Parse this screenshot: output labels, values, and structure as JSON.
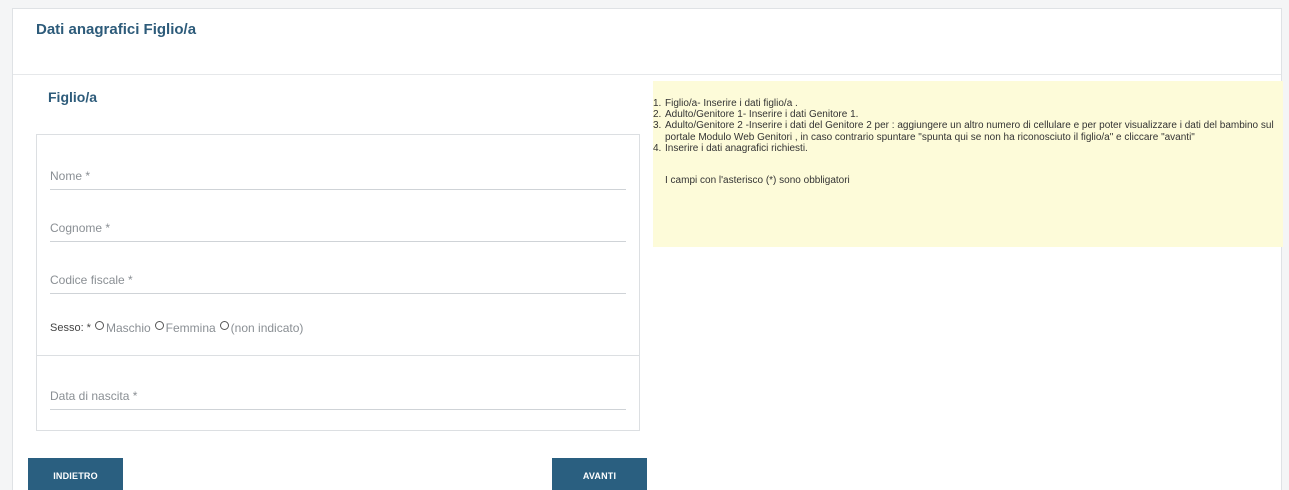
{
  "page": {
    "title": "Dati anagrafici Figlio/a"
  },
  "section": {
    "title": "Figlio/a"
  },
  "form": {
    "nome_placeholder": "Nome *",
    "cognome_placeholder": "Cognome *",
    "codice_fiscale_placeholder": "Codice fiscale *",
    "sesso_label": "Sesso: *",
    "sesso_options": [
      "Maschio",
      "Femmina",
      "(non indicato)"
    ],
    "data_nascita_placeholder": "Data di nascita *"
  },
  "help": {
    "items": [
      {
        "num": "1.",
        "text": "Figlio/a-  Inserire i dati figlio/a ."
      },
      {
        "num": "2.",
        "text": "Adulto/Genitore 1-  Inserire i dati Genitore 1."
      },
      {
        "num": "3.",
        "text": "Adulto/Genitore 2  -Inserire i dati del Genitore 2 per : aggiungere un altro numero di cellulare e per poter visualizzare i dati del bambino sul portale Modulo     Web  Genitori , in caso contrario spuntare \"spunta qui se non ha riconosciuto il figlio/a\" e cliccare \"avanti\""
      },
      {
        "num": "4.",
        "text": "Inserire i dati anagrafici richiesti."
      }
    ],
    "note": "I campi con l'asterisco (*) sono obbligatori"
  },
  "buttons": {
    "back_label": "INDIETRO",
    "next_label": "AVANTI"
  },
  "colors": {
    "brand": "#2a5f80",
    "title": "#2d5b7a",
    "help_bg": "#fdfbd9"
  }
}
